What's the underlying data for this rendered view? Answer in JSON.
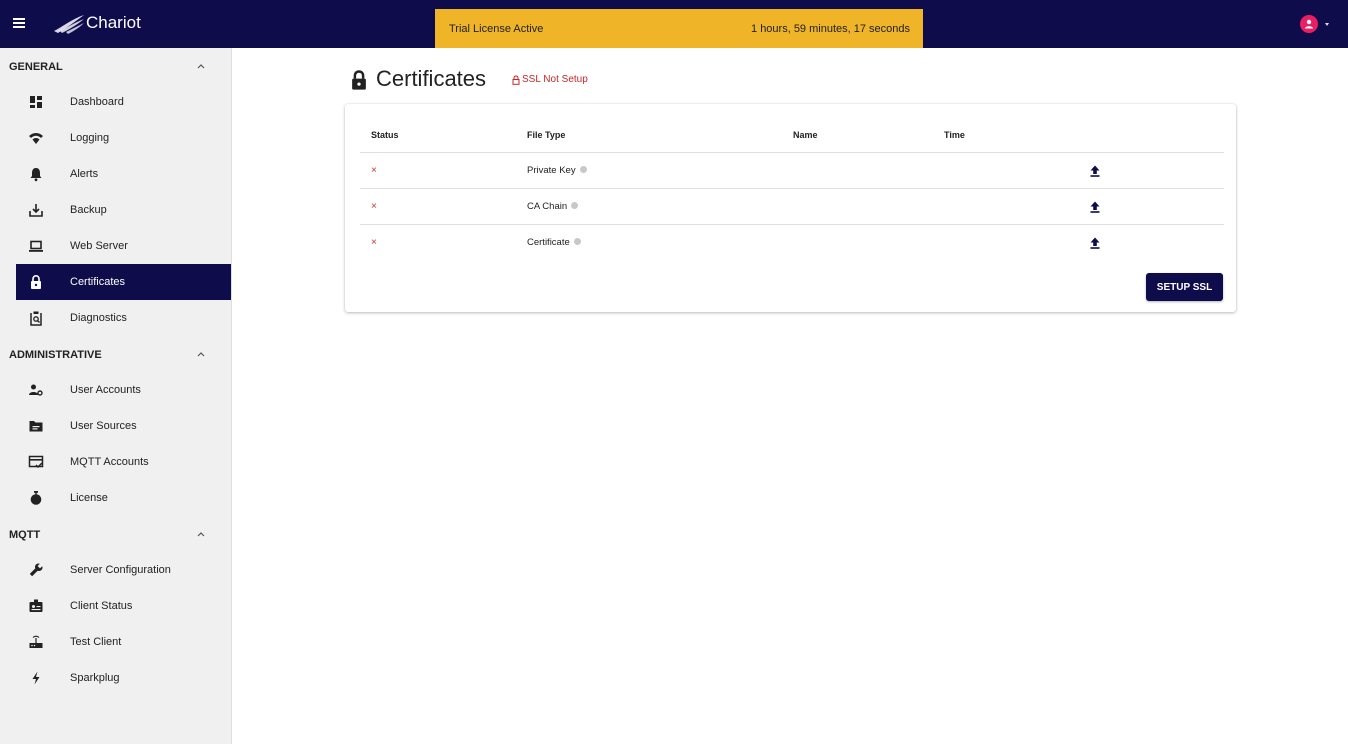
{
  "app": {
    "title": "Chariot",
    "license_banner": {
      "label": "Trial License Active",
      "time_remaining": "1 hours, 59 minutes, 17 seconds"
    }
  },
  "colors": {
    "topbar": "#0f0c4b",
    "banner": "#efb428",
    "active_nav": "#0f0c4b",
    "error": "#d32f2f",
    "avatar": "#e91e63"
  },
  "sidebar": {
    "sections": [
      {
        "title": "GENERAL",
        "items": [
          {
            "label": "Dashboard",
            "icon": "dashboard-icon"
          },
          {
            "label": "Logging",
            "icon": "wifi-icon"
          },
          {
            "label": "Alerts",
            "icon": "bell-icon"
          },
          {
            "label": "Backup",
            "icon": "download-tray-icon"
          },
          {
            "label": "Web Server",
            "icon": "laptop-icon"
          },
          {
            "label": "Certificates",
            "icon": "lock-icon",
            "active": true
          },
          {
            "label": "Diagnostics",
            "icon": "clipboard-search-icon"
          }
        ]
      },
      {
        "title": "ADMINISTRATIVE",
        "items": [
          {
            "label": "User Accounts",
            "icon": "user-cog-icon"
          },
          {
            "label": "User Sources",
            "icon": "folder-icon"
          },
          {
            "label": "MQTT Accounts",
            "icon": "card-check-icon"
          },
          {
            "label": "License",
            "icon": "stopwatch-icon"
          }
        ]
      },
      {
        "title": "MQTT",
        "items": [
          {
            "label": "Server Configuration",
            "icon": "wrench-icon"
          },
          {
            "label": "Client Status",
            "icon": "badge-icon"
          },
          {
            "label": "Test Client",
            "icon": "router-icon"
          },
          {
            "label": "Sparkplug",
            "icon": "bolt-icon"
          }
        ]
      }
    ]
  },
  "main": {
    "title": "Certificates",
    "ssl_status": "SSL Not Setup",
    "table": {
      "columns": [
        "Status",
        "File Type",
        "Name",
        "Time"
      ],
      "rows": [
        {
          "status": "×",
          "file_type": "Private Key",
          "name": "",
          "time": ""
        },
        {
          "status": "×",
          "file_type": "CA Chain",
          "name": "",
          "time": ""
        },
        {
          "status": "×",
          "file_type": "Certificate",
          "name": "",
          "time": ""
        }
      ]
    },
    "setup_button": "SETUP SSL"
  }
}
